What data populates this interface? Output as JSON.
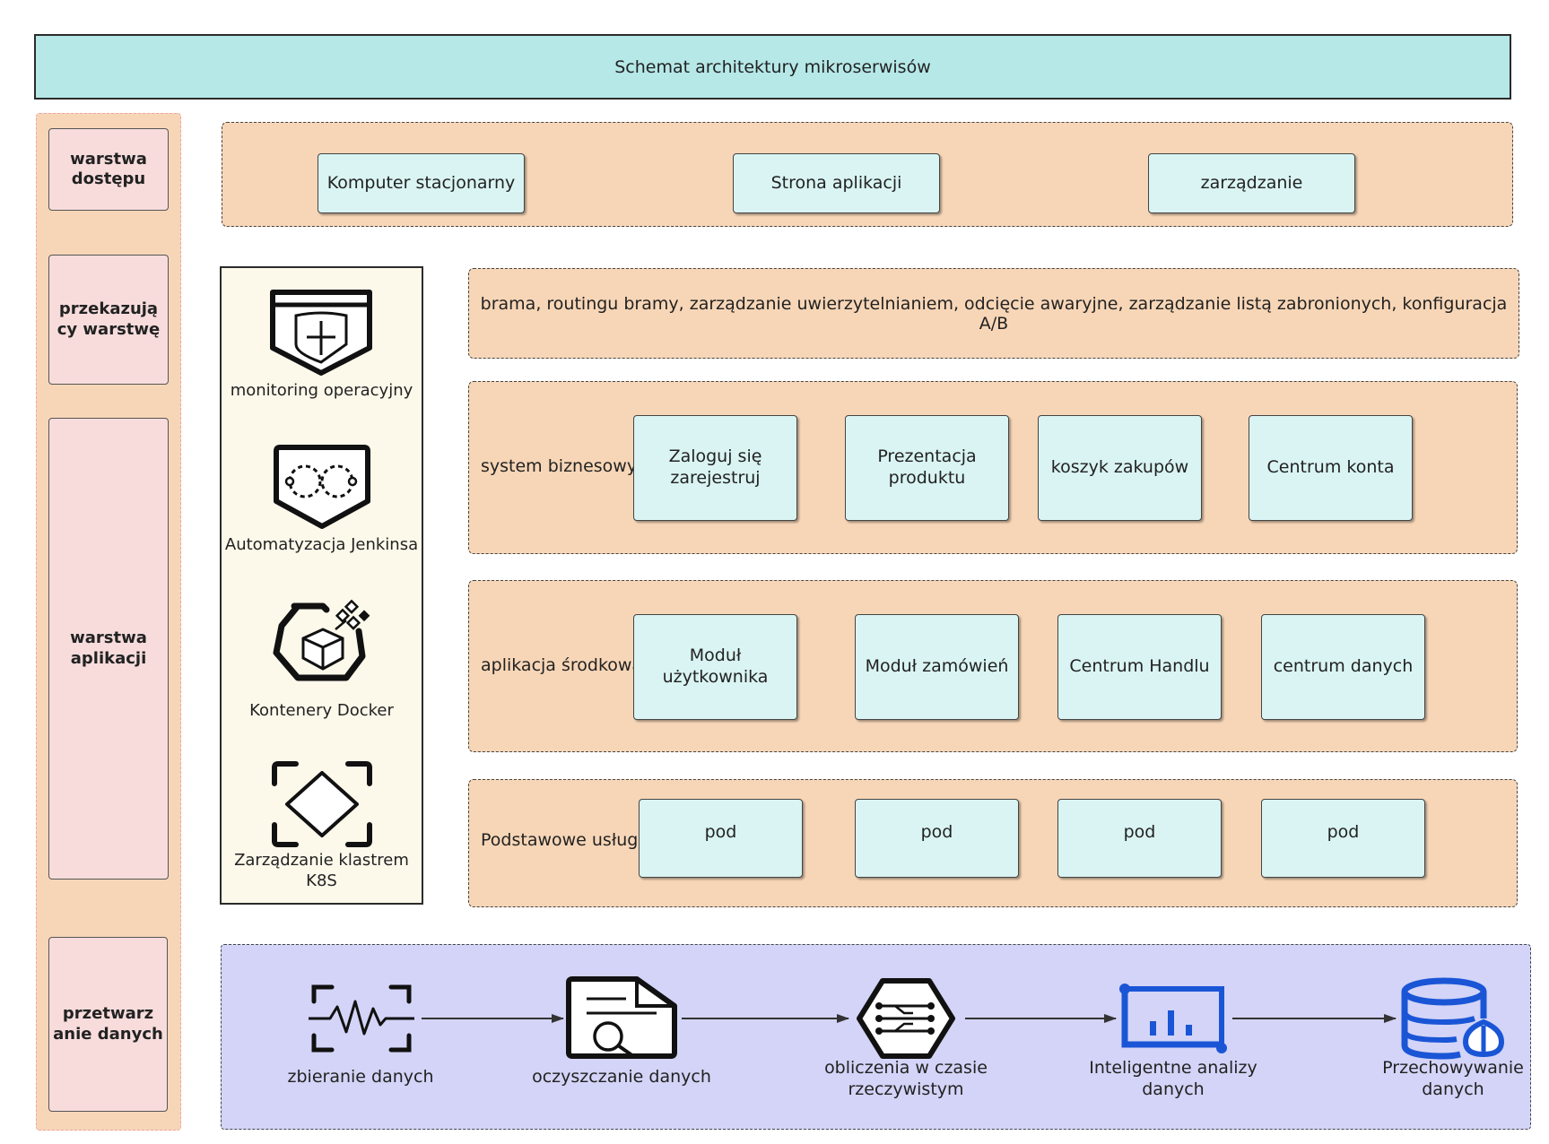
{
  "title": "Schemat architektury mikroserwisów",
  "layers": {
    "access": "warstwa dostępu",
    "forwarding": "przekazują cy warstwę",
    "application": "warstwa aplikacji",
    "data": "przetwarz anie danych"
  },
  "access_layer": {
    "items": [
      "Komputer stacjonarny",
      "Strona aplikacji",
      "zarządzanie"
    ]
  },
  "gateway": {
    "text": "brama, routingu bramy, zarządzanie uwierzytelnianiem, odcięcie awaryjne, zarządzanie listą zabronionych, konfiguracja A/B"
  },
  "business_system": {
    "label": "system biznesowy",
    "items": [
      "Zaloguj się zarejestruj",
      "Prezentacja produktu",
      "koszyk zakupów",
      "Centrum konta"
    ]
  },
  "middle_app": {
    "label": "aplikacja środkowa",
    "items": [
      "Moduł użytkownika",
      "Moduł zamówień",
      "Centrum Handlu",
      "centrum danych"
    ]
  },
  "basic_services": {
    "label": "Podstawowe usługi",
    "items": [
      "pod",
      "pod",
      "pod",
      "pod"
    ]
  },
  "devops": {
    "items": [
      {
        "icon": "shield-plus-icon",
        "label": "monitoring operacyjny"
      },
      {
        "icon": "infinity-shield-icon",
        "label": "Automatyzacja Jenkinsa"
      },
      {
        "icon": "docker-cube-icon",
        "label": "Kontenery Docker"
      },
      {
        "icon": "k8s-diamond-icon",
        "label": "Zarządzanie klastrem K8S"
      }
    ]
  },
  "data_pipeline": {
    "steps": [
      {
        "icon": "waveform-icon",
        "label": "zbieranie danych"
      },
      {
        "icon": "document-search-icon",
        "label": "oczyszczanie danych"
      },
      {
        "icon": "hexagon-circuit-icon",
        "label": "obliczenia w czasie rzeczywistym"
      },
      {
        "icon": "bar-chart-icon",
        "label": "Inteligentne analizy danych"
      },
      {
        "icon": "database-icon",
        "label": "Przechowywanie danych"
      }
    ]
  },
  "colors": {
    "title_bg": "#b6e8e8",
    "layer_bg": "#f7d6b7",
    "label_bg": "#f8dcdc",
    "service_bg": "#d9f4f3",
    "devops_bg": "#fcf8ea",
    "data_bg": "#d3d4f7",
    "blue_icons": "#1a55d6"
  }
}
